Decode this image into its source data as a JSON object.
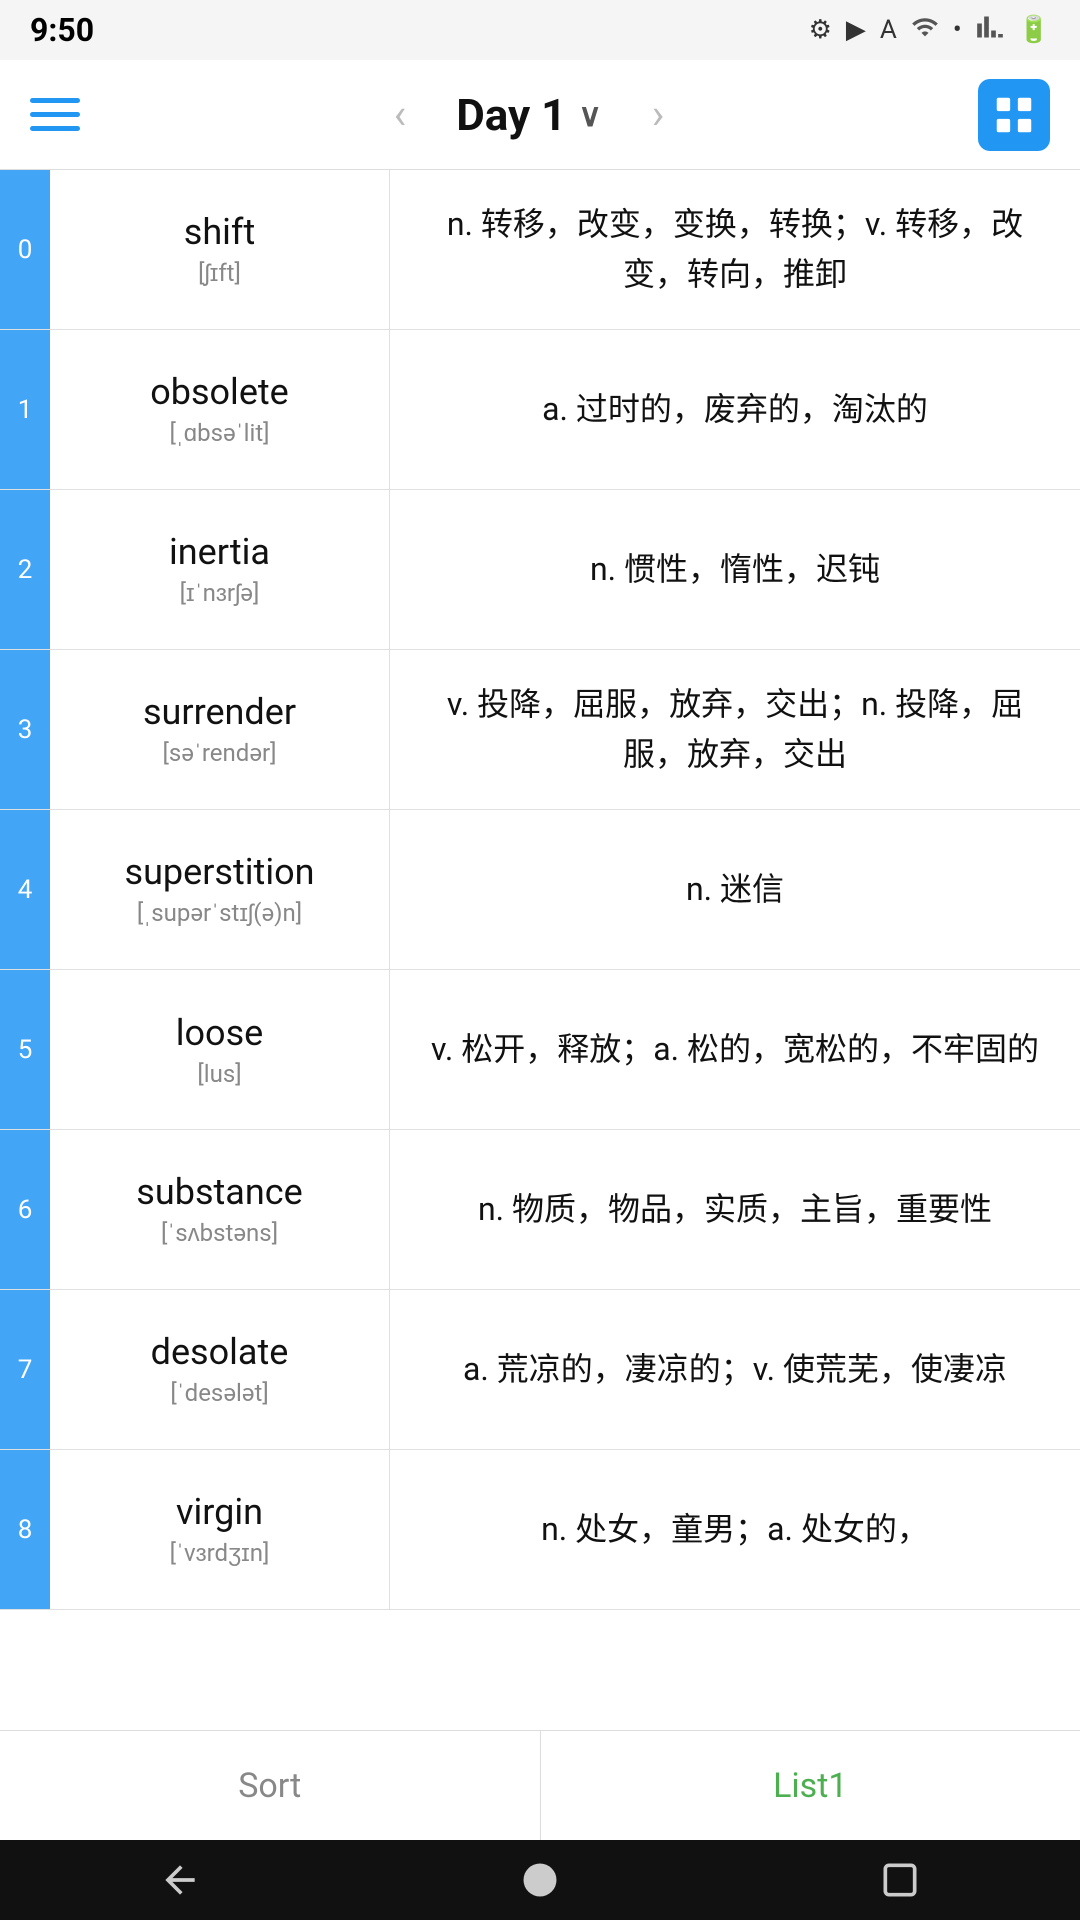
{
  "statusBar": {
    "time": "9:50",
    "icons": [
      "settings",
      "play",
      "A",
      "wifi",
      "dot",
      "signal",
      "battery"
    ]
  },
  "toolbar": {
    "title": "Day 1",
    "prevArrow": "‹",
    "nextArrow": "›"
  },
  "words": [
    {
      "index": "0",
      "english": "shift",
      "phonetic": "[ʃɪft]",
      "definition": "n. 转移，改变，变换，转换；v. 转移，改变，转向，推卸"
    },
    {
      "index": "1",
      "english": "obsolete",
      "phonetic": "[ˌɑbsəˈlit]",
      "definition": "a. 过时的，废弃的，淘汰的"
    },
    {
      "index": "2",
      "english": "inertia",
      "phonetic": "[ɪˈnɜrʃə]",
      "definition": "n. 惯性，惰性，迟钝"
    },
    {
      "index": "3",
      "english": "surrender",
      "phonetic": "[səˈrendər]",
      "definition": "v. 投降，屈服，放弃，交出；n. 投降，屈服，放弃，交出"
    },
    {
      "index": "4",
      "english": "superstition",
      "phonetic": "[ˌsupərˈstɪʃ(ə)n]",
      "definition": "n. 迷信"
    },
    {
      "index": "5",
      "english": "loose",
      "phonetic": "[lus]",
      "definition": "v. 松开，释放；a. 松的，宽松的，不牢固的"
    },
    {
      "index": "6",
      "english": "substance",
      "phonetic": "[ˈsʌbstəns]",
      "definition": "n. 物质，物品，实质，主旨，重要性"
    },
    {
      "index": "7",
      "english": "desolate",
      "phonetic": "[ˈdesələt]",
      "definition": "a. 荒凉的，凄凉的；v. 使荒芜，使凄凉"
    },
    {
      "index": "8",
      "english": "virgin",
      "phonetic": "[ˈvɜrdʒɪn]",
      "definition": "n. 处女，童男；a. 处女的，"
    }
  ],
  "bottomTabs": {
    "sort": "Sort",
    "list1": "List1"
  },
  "navBar": {
    "back": "back",
    "home": "home",
    "recent": "recent"
  }
}
